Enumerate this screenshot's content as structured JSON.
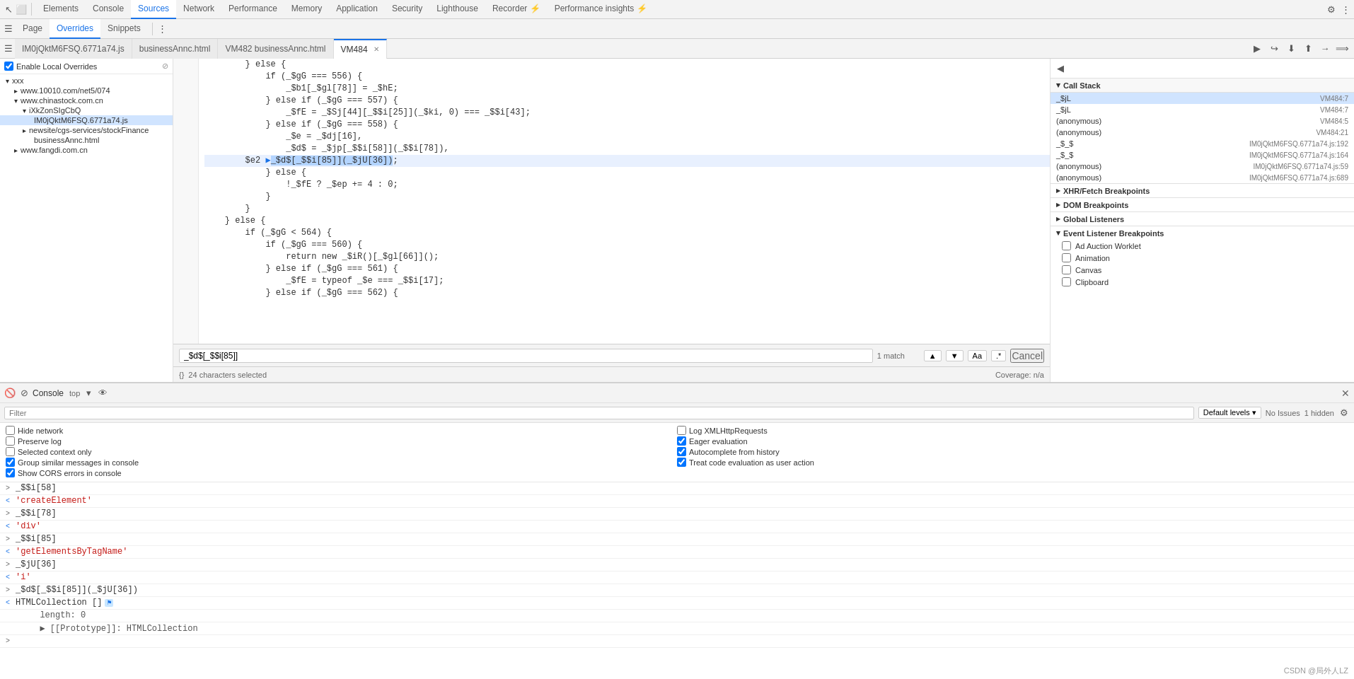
{
  "toolbar": {
    "tabs": [
      {
        "label": "Elements",
        "active": false
      },
      {
        "label": "Console",
        "active": false
      },
      {
        "label": "Sources",
        "active": true
      },
      {
        "label": "Network",
        "active": false
      },
      {
        "label": "Performance",
        "active": false
      },
      {
        "label": "Memory",
        "active": false
      },
      {
        "label": "Application",
        "active": false
      },
      {
        "label": "Security",
        "active": false
      },
      {
        "label": "Lighthouse",
        "active": false
      },
      {
        "label": "Recorder ⚡",
        "active": false
      },
      {
        "label": "Performance insights ⚡",
        "active": false
      }
    ]
  },
  "sources_tabs": {
    "sub_tabs": [
      {
        "label": "Page",
        "active": false
      },
      {
        "label": "Overrides",
        "active": true
      },
      {
        "label": "Snippets",
        "active": false
      }
    ],
    "file_tabs": [
      {
        "label": "IM0jQktM6FSQ.6771a74.js",
        "active": false,
        "closeable": false
      },
      {
        "label": "businessAnnc.html",
        "active": false,
        "closeable": false
      },
      {
        "label": "VM482 businessAnnc.html",
        "active": false,
        "closeable": false
      },
      {
        "label": "VM484",
        "active": true,
        "closeable": true
      }
    ]
  },
  "sidebar": {
    "override_label": "Enable Local Overrides",
    "tree": [
      {
        "label": "xxx",
        "type": "folder",
        "level": 0,
        "expanded": true
      },
      {
        "label": "www.10010.com/net5/074",
        "type": "folder",
        "level": 1,
        "expanded": false
      },
      {
        "label": "www.chinastock.com.cn",
        "type": "folder",
        "level": 1,
        "expanded": true
      },
      {
        "label": "iXkZonSIgCbQ",
        "type": "folder",
        "level": 2,
        "expanded": true
      },
      {
        "label": "IM0jQktM6FSQ.6771a74.js",
        "type": "file",
        "level": 3,
        "selected": true
      },
      {
        "label": "newsite/cgs-services/stockFinance",
        "type": "folder",
        "level": 2,
        "expanded": false
      },
      {
        "label": "businessAnnc.html",
        "type": "file",
        "level": 3
      },
      {
        "label": "www.fangdi.com.cn",
        "type": "folder",
        "level": 1,
        "expanded": false
      }
    ]
  },
  "code": {
    "lines": [
      {
        "num": "",
        "text": "} else {"
      },
      {
        "num": "",
        "text": "    if (_$gG === 556) {"
      },
      {
        "num": "",
        "text": "        _$b1[_$gl[78]] = _$hE;"
      },
      {
        "num": "",
        "text": "    } else if (_$gG === 557) {"
      },
      {
        "num": "",
        "text": "        _$fE = _$Sj[44][_$$i[25]](_$ki, 0) === _$$i[43];"
      },
      {
        "num": "",
        "text": "    } else if (_$gG === 558) {"
      },
      {
        "num": "",
        "text": "        _$e = _$dj[16],"
      },
      {
        "num": "",
        "text": "        _$d$ = _$jp[_$$i[58]](_$$i[78]),"
      },
      {
        "num": "",
        "text": "        $e2 ▶█ _$d$[_$$i[85]](_$jU[36]);",
        "highlight": true
      },
      {
        "num": "",
        "text": "    } else {"
      },
      {
        "num": "",
        "text": "        !_$fE ? _$ep += 4 : 0;"
      },
      {
        "num": "",
        "text": "    }"
      },
      {
        "num": "",
        "text": "}"
      },
      {
        "num": "",
        "text": "} else {"
      },
      {
        "num": "",
        "text": "    if (_$gG < 564) {"
      },
      {
        "num": "",
        "text": "        if (_$gG === 560) {"
      },
      {
        "num": "",
        "text": "            return new _$iR()[_$gl[66]]();"
      },
      {
        "num": "",
        "text": "        } else if (_$gG === 561) {"
      },
      {
        "num": "",
        "text": "            _$fE = typeof _$e === _$$i[17];"
      },
      {
        "num": "",
        "text": "        } else if (_$gG === 562) {"
      }
    ],
    "line_numbers": [
      "",
      "",
      "",
      "",
      "",
      "",
      "",
      "",
      "",
      "",
      "",
      "",
      "",
      "",
      "",
      "",
      "",
      "",
      "",
      ""
    ]
  },
  "find_bar": {
    "query": "_$d$[_$$i[85]]",
    "matches": "1 match",
    "aa_label": "Aa",
    "regex_label": ".*",
    "cancel_label": "Cancel"
  },
  "status_bar": {
    "chars_selected": "24 characters selected",
    "coverage": "Coverage: n/a"
  },
  "right_panel": {
    "call_stack": [
      {
        "name": "_$jL",
        "location": "VM484:7",
        "selected": true
      },
      {
        "name": "_$jL",
        "location": "VM484:7"
      },
      {
        "name": "(anonymous)",
        "location": "VM484:5"
      },
      {
        "name": "(anonymous)",
        "location": "VM484:21"
      },
      {
        "name": "_$_$",
        "location": "IM0jQktM6FSQ.6771a74.js:192"
      },
      {
        "name": "_$_$",
        "location": "IM0jQktM6FSQ.6771a74.js:164"
      },
      {
        "name": "(anonymous)",
        "location": "IM0jQktM6FSQ.6771a74.js:59"
      },
      {
        "name": "(anonymous)",
        "location": "IM0jQktM6FSQ.6771a74.js:689"
      }
    ],
    "breakpoints": [
      {
        "section": "XHR/Fetch Breakpoints",
        "expanded": false
      },
      {
        "section": "DOM Breakpoints",
        "expanded": false
      },
      {
        "section": "Global Listeners",
        "expanded": false
      },
      {
        "section": "Event Listener Breakpoints",
        "expanded": true,
        "items": [
          {
            "label": "Ad Auction Worklet",
            "checked": false
          },
          {
            "label": "Animation",
            "checked": false
          },
          {
            "label": "Canvas",
            "checked": false
          },
          {
            "label": "Clipboard",
            "checked": false
          }
        ]
      }
    ]
  },
  "console": {
    "title": "Console",
    "filter_placeholder": "Filter",
    "levels_label": "Default levels ▾",
    "no_issues": "No Issues",
    "hidden_count": "1 hidden",
    "options": [
      {
        "label": "Hide network",
        "checked": false
      },
      {
        "label": "Preserve log",
        "checked": false
      },
      {
        "label": "Selected context only",
        "checked": false
      },
      {
        "label": "Group similar messages in console",
        "checked": true
      },
      {
        "label": "Show CORS errors in console",
        "checked": true
      },
      {
        "label": "Log XMLHttpRequests",
        "checked": false
      },
      {
        "label": "Eager evaluation",
        "checked": true
      },
      {
        "label": "Autocomplete from history",
        "checked": true
      },
      {
        "label": "Treat code evaluation as user action",
        "checked": true
      }
    ],
    "log_entries": [
      {
        "arrow": ">",
        "content": "_$$i[58]",
        "type": "var",
        "expandable": true
      },
      {
        "arrow": "<",
        "content": "'createElement'",
        "type": "string",
        "expandable": false
      },
      {
        "arrow": ">",
        "content": "_$$i[78]",
        "type": "var",
        "expandable": true
      },
      {
        "arrow": "<",
        "content": "'div'",
        "type": "string",
        "expandable": false
      },
      {
        "arrow": ">",
        "content": "_$$i[85]",
        "type": "var",
        "expandable": true
      },
      {
        "arrow": "<",
        "content": "'getElementsByTagName'",
        "type": "string",
        "expandable": false
      },
      {
        "arrow": ">",
        "content": "_$jU[36]",
        "type": "var",
        "expandable": true
      },
      {
        "arrow": "<",
        "content": "'i'",
        "type": "string",
        "expandable": false
      },
      {
        "arrow": ">",
        "content": "_$d$[_$$i[85]](_$jU[36])",
        "type": "var",
        "expandable": true
      },
      {
        "arrow": "<",
        "content": "HTMLCollection [] ",
        "type": "collection",
        "expandable": true,
        "badge": true
      },
      {
        "arrow": " ",
        "content": "  length: 0",
        "type": "indent"
      },
      {
        "arrow": " ",
        "content": "  ▶ [[Prototype]]: HTMLCollection",
        "type": "indent"
      }
    ]
  },
  "watermark": "CSDN @局外人LZ"
}
